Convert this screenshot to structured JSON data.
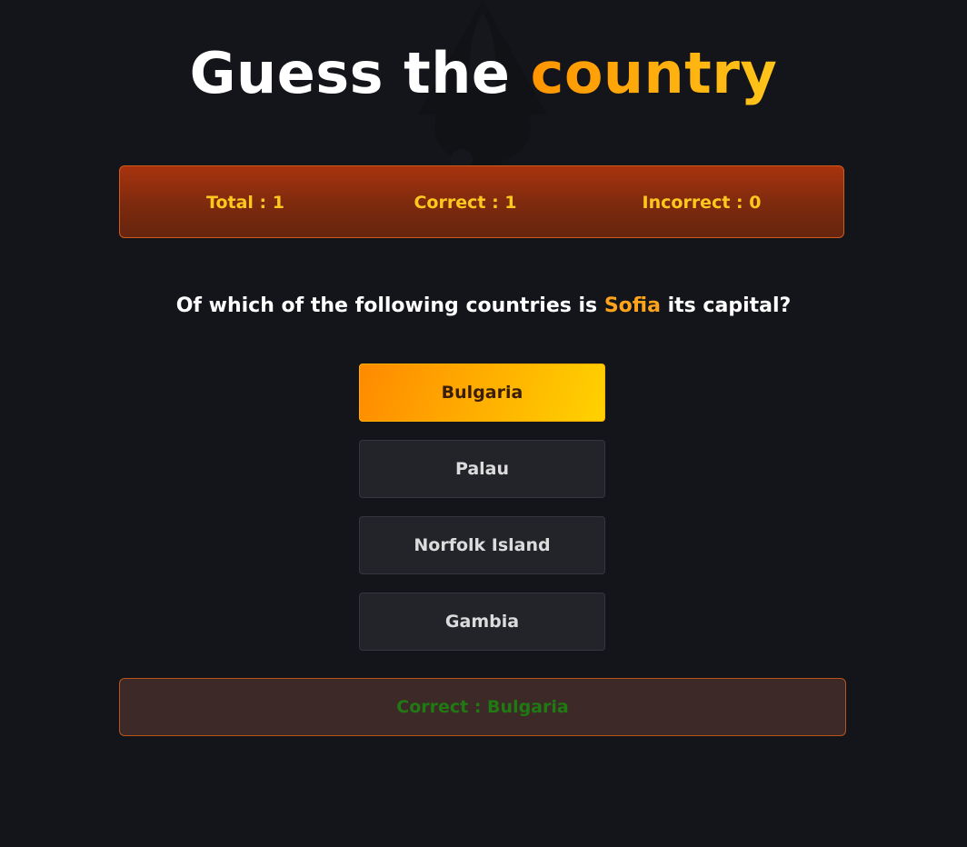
{
  "header": {
    "title_part1": "Guess the",
    "title_part2": "country"
  },
  "scoreboard": {
    "total": "Total : 1",
    "correct": "Correct : 1",
    "incorrect": "Incorrect : 0"
  },
  "question": {
    "prefix": "Of which of the following countries is",
    "capital": "Sofia",
    "suffix": "its capital?"
  },
  "options": [
    {
      "label": "Bulgaria",
      "selected": true
    },
    {
      "label": "Palau",
      "selected": false
    },
    {
      "label": "Norfolk Island",
      "selected": false
    },
    {
      "label": "Gambia",
      "selected": false
    }
  ],
  "result": {
    "text": "Correct : Bulgaria"
  },
  "colors": {
    "background": "#14151a",
    "accent_start": "#ff9500",
    "accent_end": "#ffc51a",
    "score_text": "#ffc81e",
    "correct_text": "#1f7a12"
  },
  "icons": {
    "watermark": "rocket-icon"
  }
}
